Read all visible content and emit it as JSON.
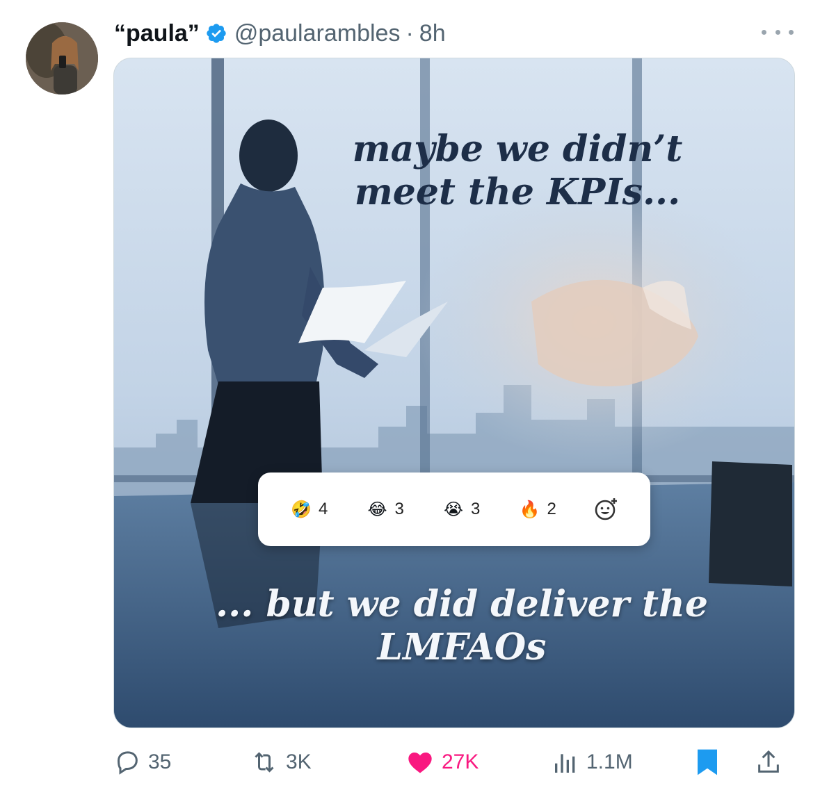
{
  "post": {
    "display_name": "“paula”",
    "handle": "@paularambles",
    "separator": "·",
    "time": "8h",
    "verified": true
  },
  "media": {
    "caption_top": "maybe we didn’t meet the KPIs...",
    "caption_bottom": "... but we did deliver the LMFAOs",
    "reactions": [
      {
        "emoji": "🤣",
        "count": "4"
      },
      {
        "emoji": "😂",
        "count": "3"
      },
      {
        "emoji": "😭",
        "count": "3"
      },
      {
        "emoji": "🔥",
        "count": "2"
      }
    ]
  },
  "actions": {
    "replies": "35",
    "reposts": "3K",
    "likes": "27K",
    "views": "1.1M"
  },
  "colors": {
    "verified": "#1d9bf0",
    "like": "#f91880",
    "muted": "#536471",
    "bookmark": "#1d9bf0"
  },
  "icons": [
    "verified-badge-icon",
    "more-icon",
    "reply-icon",
    "repost-icon",
    "like-icon",
    "views-icon",
    "bookmark-icon",
    "share-icon",
    "add-reaction-icon"
  ]
}
